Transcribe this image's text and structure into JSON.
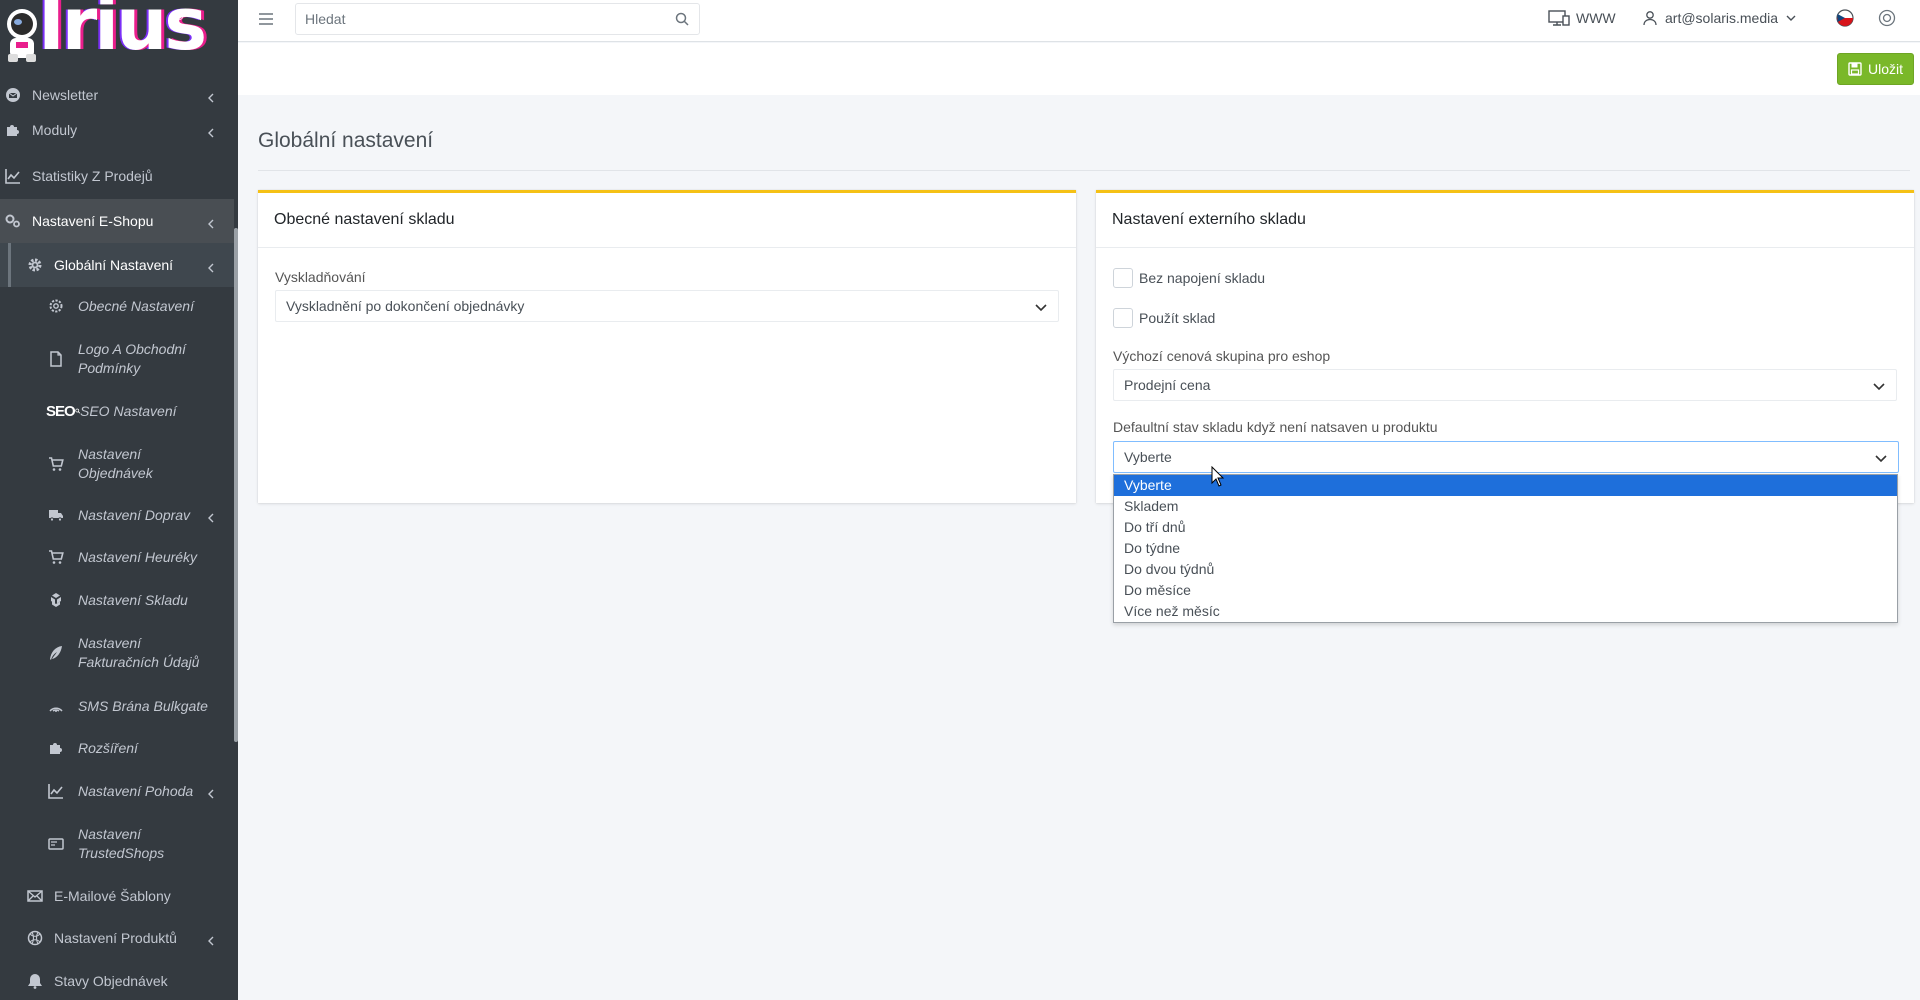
{
  "sidebar": {
    "logo_text": "Irius",
    "logo_reg": "®",
    "items": [
      {
        "label": "Newsletter",
        "icon": "envelope-circle-icon",
        "has_arrow": true
      },
      {
        "label": "Moduly",
        "icon": "puzzle-icon",
        "has_arrow": true
      },
      {
        "label": "Statistiky Z Prodejů",
        "icon": "chart-line-icon",
        "has_arrow": false
      },
      {
        "label": "Nastavení E-Shopu",
        "icon": "cogs-icon",
        "has_arrow": true
      },
      {
        "label": "Globální Nastavení",
        "icon": "gear-icon",
        "has_arrow": true
      },
      {
        "label": "Obecné Nastavení",
        "icon": "gear-outline-icon"
      },
      {
        "label": "Logo A Obchodní Podmínky",
        "icon": "file-icon"
      },
      {
        "label": "SEO Nastavení",
        "icon": "seo-icon",
        "icon_text": "SEO"
      },
      {
        "label": "Nastavení Objednávek",
        "icon": "cart-icon"
      },
      {
        "label": "Nastavení Doprav",
        "icon": "truck-icon",
        "has_arrow": true
      },
      {
        "label": "Nastavení Heuréky",
        "icon": "cart-icon"
      },
      {
        "label": "Nastavení Skladu",
        "icon": "boxes-icon"
      },
      {
        "label": "Nastavení Fakturačních Údajů",
        "icon": "feather-icon"
      },
      {
        "label": "SMS Brána Bulkgate",
        "icon": "signal-icon"
      },
      {
        "label": "Rozšíření",
        "icon": "puzzle-icon"
      },
      {
        "label": "Nastavení Pohoda",
        "icon": "chart-line-icon",
        "has_arrow": true
      },
      {
        "label": "Nastavení TrustedShops",
        "icon": "card-icon"
      },
      {
        "label": "E-Mailové Šablony",
        "icon": "envelope-icon"
      },
      {
        "label": "Nastavení Produktů",
        "icon": "globe-icon",
        "has_arrow": true
      },
      {
        "label": "Stavy Objednávek",
        "icon": "bell-icon"
      }
    ]
  },
  "topbar": {
    "search_placeholder": "Hledat",
    "www_label": "WWW",
    "user_email": "art@solaris.media"
  },
  "toolbar": {
    "save_label": "Uložit"
  },
  "page": {
    "title": "Globální nastavení"
  },
  "card_left": {
    "title": "Obecné nastavení skladu",
    "field_label": "Vyskladňování",
    "field_value": "Vyskladnění po dokončení objednávky"
  },
  "card_right": {
    "title": "Nastavení externího skladu",
    "checkbox1": "Bez napojení skladu",
    "checkbox2": "Použít sklad",
    "price_group_label": "Výchozí cenová skupina pro eshop",
    "price_group_value": "Prodejní cena",
    "stock_state_label": "Defaultní stav skladu když není natsaven u produktu",
    "stock_state_value": "Vyberte",
    "stock_state_options": [
      "Vyberte",
      "Skladem",
      "Do tří dnů",
      "Do týdne",
      "Do dvou týdnů",
      "Do měsíce",
      "Více než měsíc"
    ],
    "selected_index": 0
  },
  "colors": {
    "sidebar_bg": "#343a40",
    "card_accent": "#f5c116",
    "save_button": "#7ab829",
    "selected_option": "#1e6fdb"
  }
}
